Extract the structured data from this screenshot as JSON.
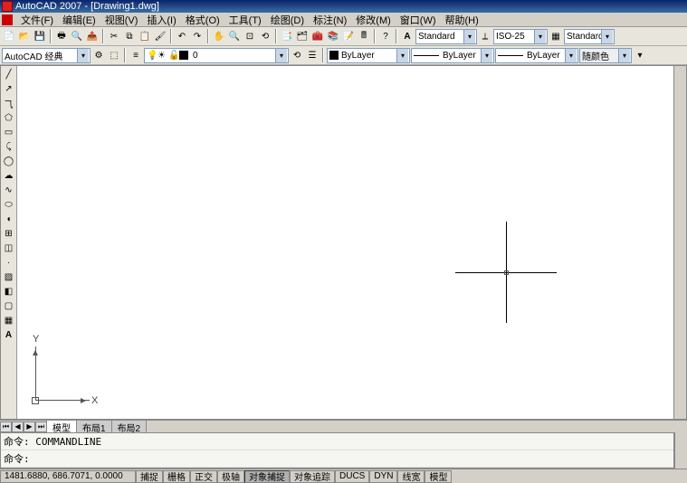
{
  "title": "AutoCAD 2007 - [Drawing1.dwg]",
  "menu": {
    "file": "文件(F)",
    "edit": "编辑(E)",
    "view": "视图(V)",
    "insert": "插入(I)",
    "format": "格式(O)",
    "tools": "工具(T)",
    "draw": "绘图(D)",
    "dimension": "标注(N)",
    "modify": "修改(M)",
    "window": "窗口(W)",
    "help": "帮助(H)"
  },
  "style_dd1": "Standard",
  "style_dd2": "ISO-25",
  "style_dd3": "Standard",
  "workspace": "AutoCAD 经典",
  "layer": {
    "name": "0"
  },
  "props": {
    "color": "ByLayer",
    "linetype": "ByLayer",
    "lineweight": "ByLayer",
    "plotstyle": "随颜色"
  },
  "ucs": {
    "x": "X",
    "y": "Y"
  },
  "tabs": {
    "model": "模型",
    "layout1": "布局1",
    "layout2": "布局2"
  },
  "cmd": {
    "line1": "命令: COMMANDLINE",
    "line2": "命令:"
  },
  "status": {
    "coords": "1481.6880, 686.7071, 0.0000",
    "snap": "捕捉",
    "grid": "栅格",
    "ortho": "正交",
    "polar": "极轴",
    "osnap": "对象捕捉",
    "otrack": "对象追踪",
    "ducs": "DUCS",
    "dyn": "DYN",
    "lwt": "线宽",
    "model": "模型"
  }
}
